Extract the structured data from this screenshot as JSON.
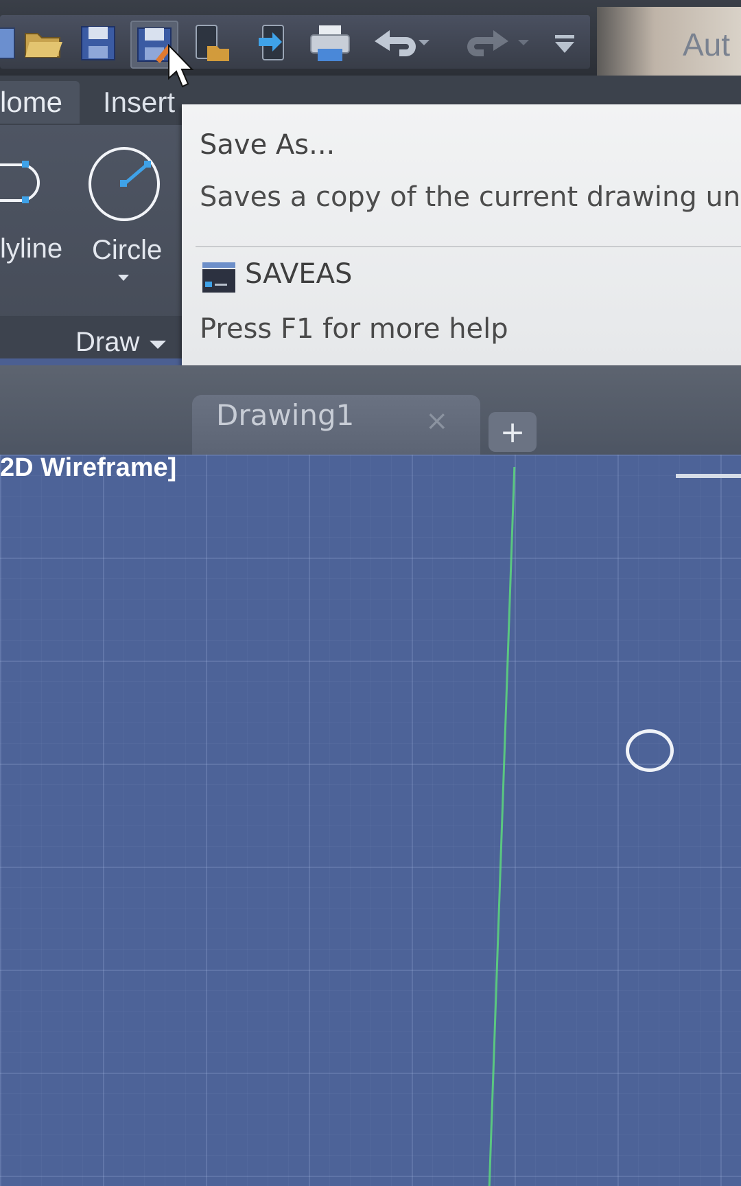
{
  "app": {
    "title": "Aut"
  },
  "quick_access": {
    "buttons": [
      {
        "name": "new-icon",
        "glyph": "▮"
      },
      {
        "name": "open-icon",
        "glyph": "📂"
      },
      {
        "name": "save-icon",
        "glyph": "💾"
      },
      {
        "name": "save-as-icon",
        "glyph": "💾"
      },
      {
        "name": "open-from-web-icon",
        "glyph": "📱"
      },
      {
        "name": "save-to-web-icon",
        "glyph": "📲"
      },
      {
        "name": "plot-icon",
        "glyph": "🖨"
      },
      {
        "name": "undo-icon",
        "glyph": "↶"
      },
      {
        "name": "redo-icon",
        "glyph": "↷"
      },
      {
        "name": "customize-icon",
        "glyph": "⩡"
      }
    ]
  },
  "ribbon": {
    "tabs": {
      "home": "lome",
      "insert": "Insert"
    },
    "tools": {
      "polyline": "lyline",
      "circle": "Circle"
    },
    "panel": {
      "draw": "Draw"
    }
  },
  "tooltip": {
    "title": "Save As...",
    "description": "Saves a copy of the current drawing unde",
    "command": "SAVEAS",
    "help": "Press F1 for more help"
  },
  "file_tabs": {
    "active": "Drawing1",
    "close": "×",
    "new_tab": "+"
  },
  "viewport": {
    "label": "2D Wireframe]"
  },
  "colors": {
    "viewport_bg": "#4d6398",
    "ribbon_bg": "#4e5563",
    "tooltip_bg": "#f2f3f4",
    "y_axis": "#5ee07a"
  }
}
